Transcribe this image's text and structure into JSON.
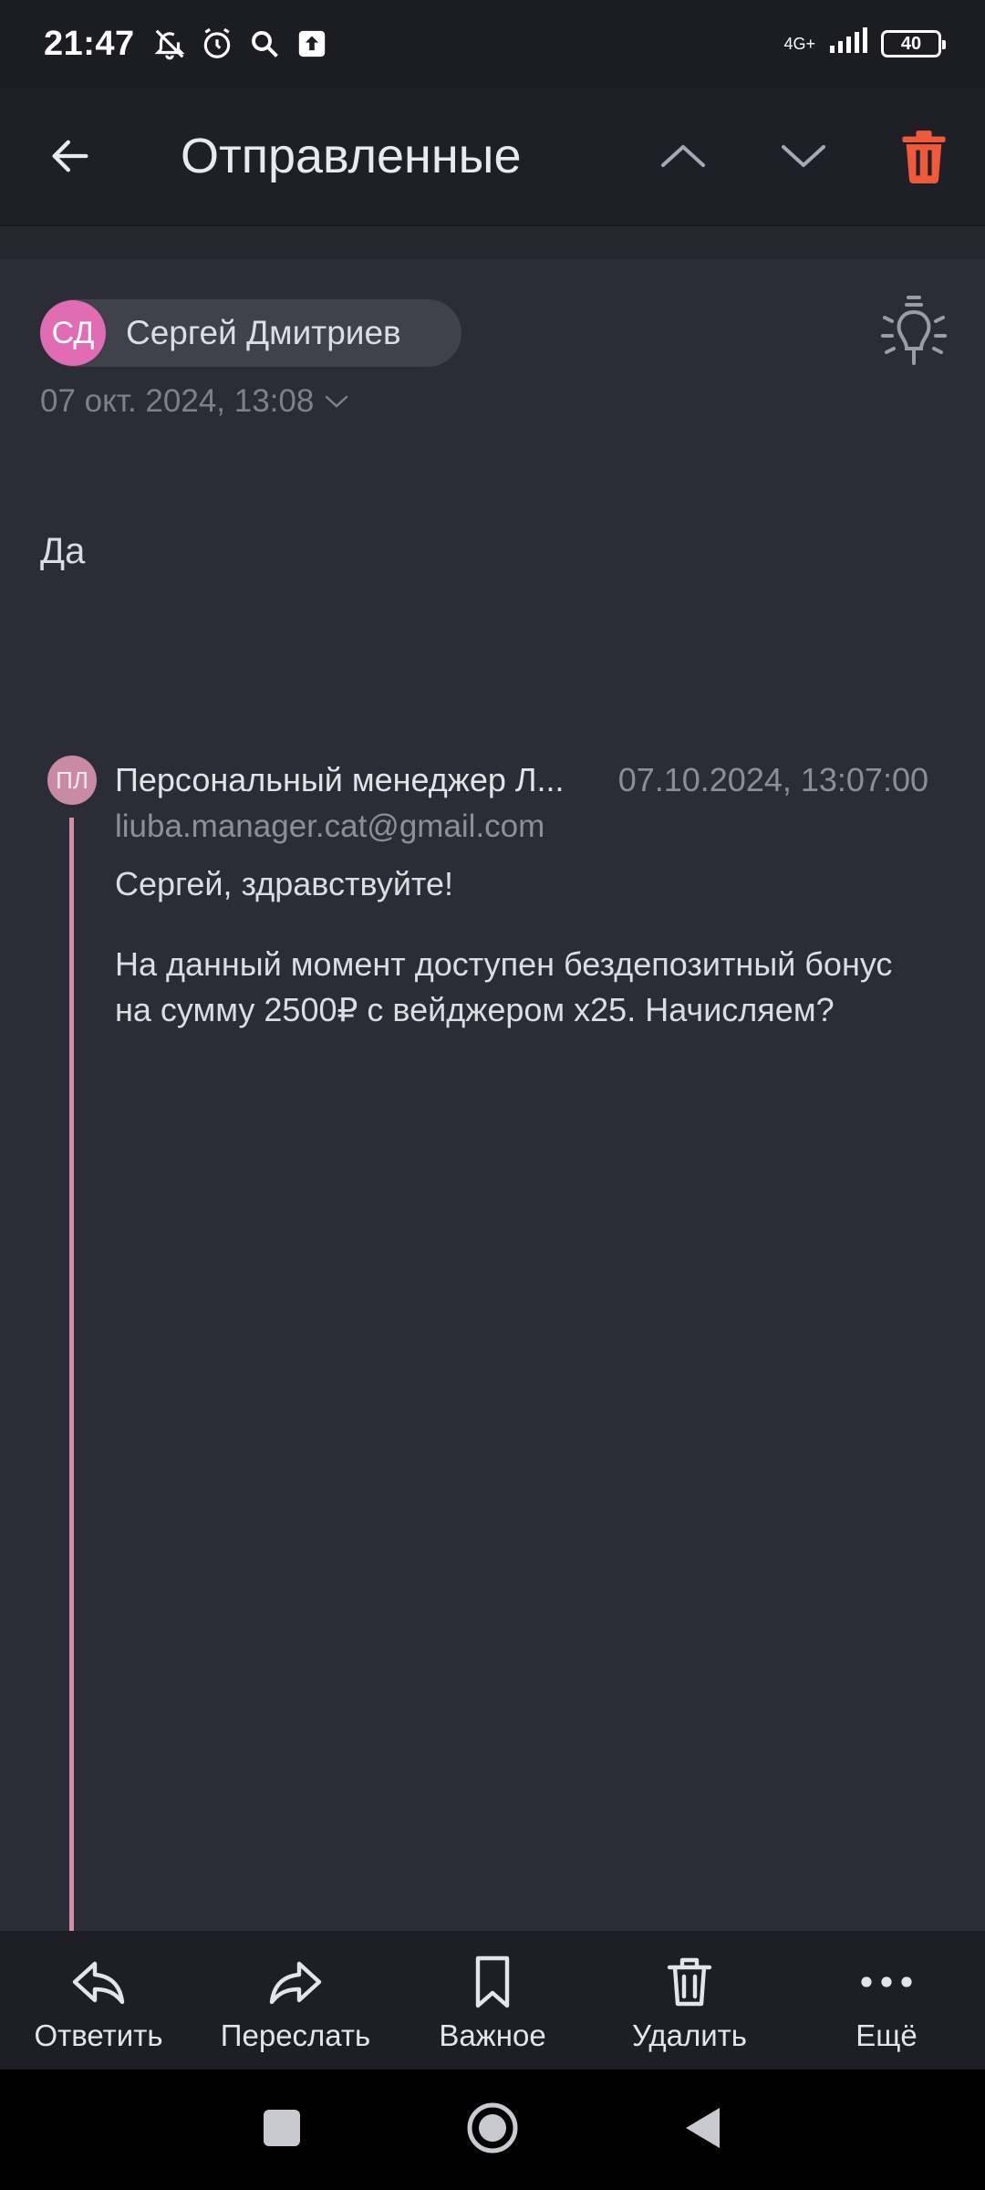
{
  "status_bar": {
    "time": "21:47",
    "network": "4G+",
    "battery": "40"
  },
  "header": {
    "title": "Отправленные",
    "delete_color": "#f05a3a"
  },
  "message": {
    "sender_initials": "СД",
    "sender_name": "Сергей Дмитриев",
    "date": "07 окт. 2024, 13:08",
    "body": "Да"
  },
  "quoted": {
    "initials": "ПЛ",
    "name": "Персональный менеджер Л...",
    "date": "07.10.2024, 13:07:00",
    "email": "liuba.manager.cat@gmail.com",
    "greeting": "Сергей, здравствуйте!",
    "body": "На данный момент доступен бездепозитный бонус на сумму 2500₽ с вейджером х25. Начисляем?"
  },
  "actions": {
    "reply": "Ответить",
    "forward": "Переслать",
    "important": "Важное",
    "delete": "Удалить",
    "more": "Ещё"
  }
}
